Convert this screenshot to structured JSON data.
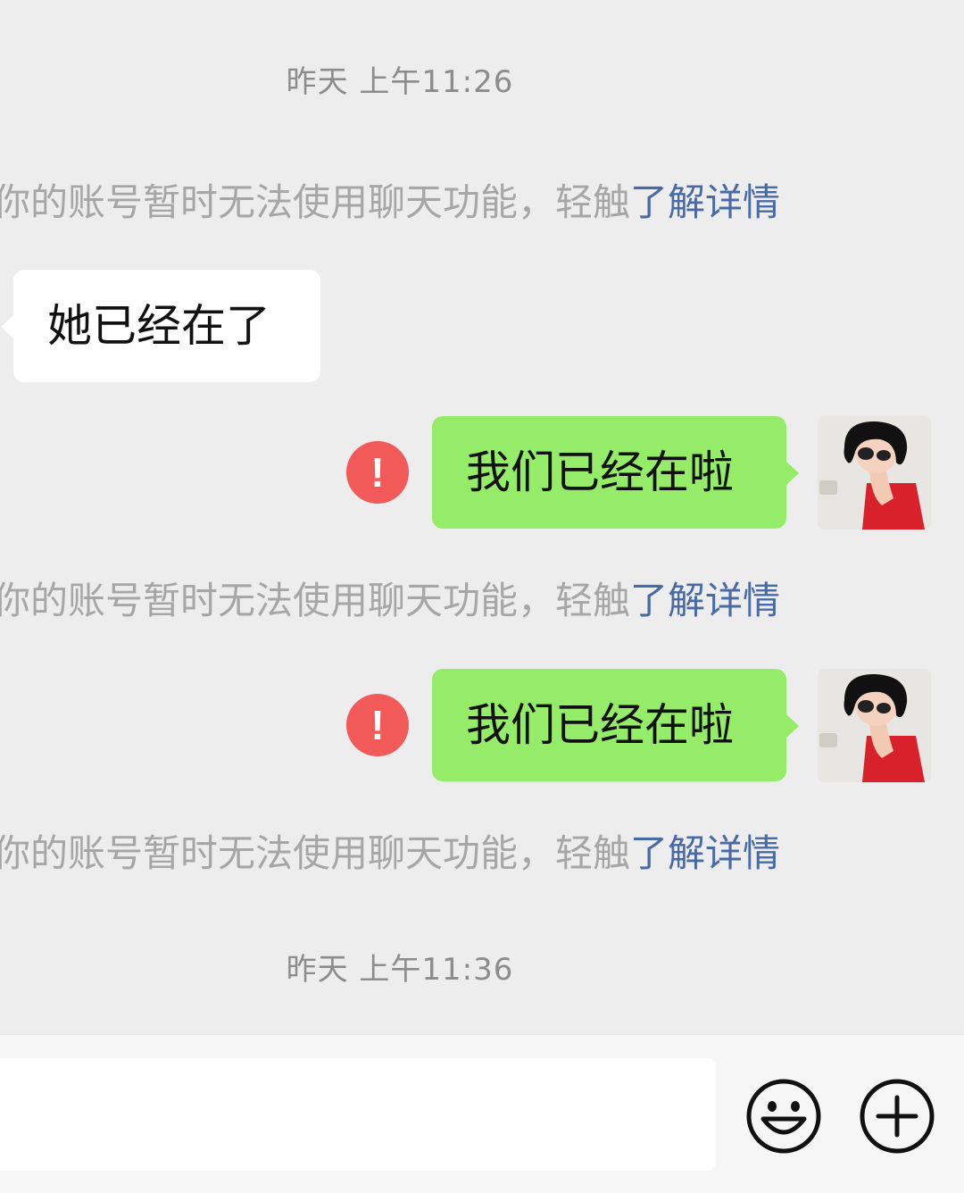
{
  "chat": {
    "timestamp_top": "昨天 上午11:26",
    "timestamp_bottom": "昨天 上午11:36",
    "notice_text": "你的账号暂时无法使用聊天功能，轻触",
    "notice_link": "了解详情",
    "received_message": "她已经在了",
    "sent_message_1": "我们已经在啦",
    "sent_message_2": "我们已经在啦",
    "error_symbol": "!"
  },
  "colors": {
    "background": "#ededed",
    "sent_bubble": "#95ec69",
    "received_bubble": "#ffffff",
    "error": "#f25a5a",
    "link": "#4a6aa5"
  },
  "icons": {
    "emoji": "emoji-icon",
    "add": "plus-circle-icon",
    "error": "exclamation-icon"
  },
  "input": {
    "placeholder": ""
  }
}
